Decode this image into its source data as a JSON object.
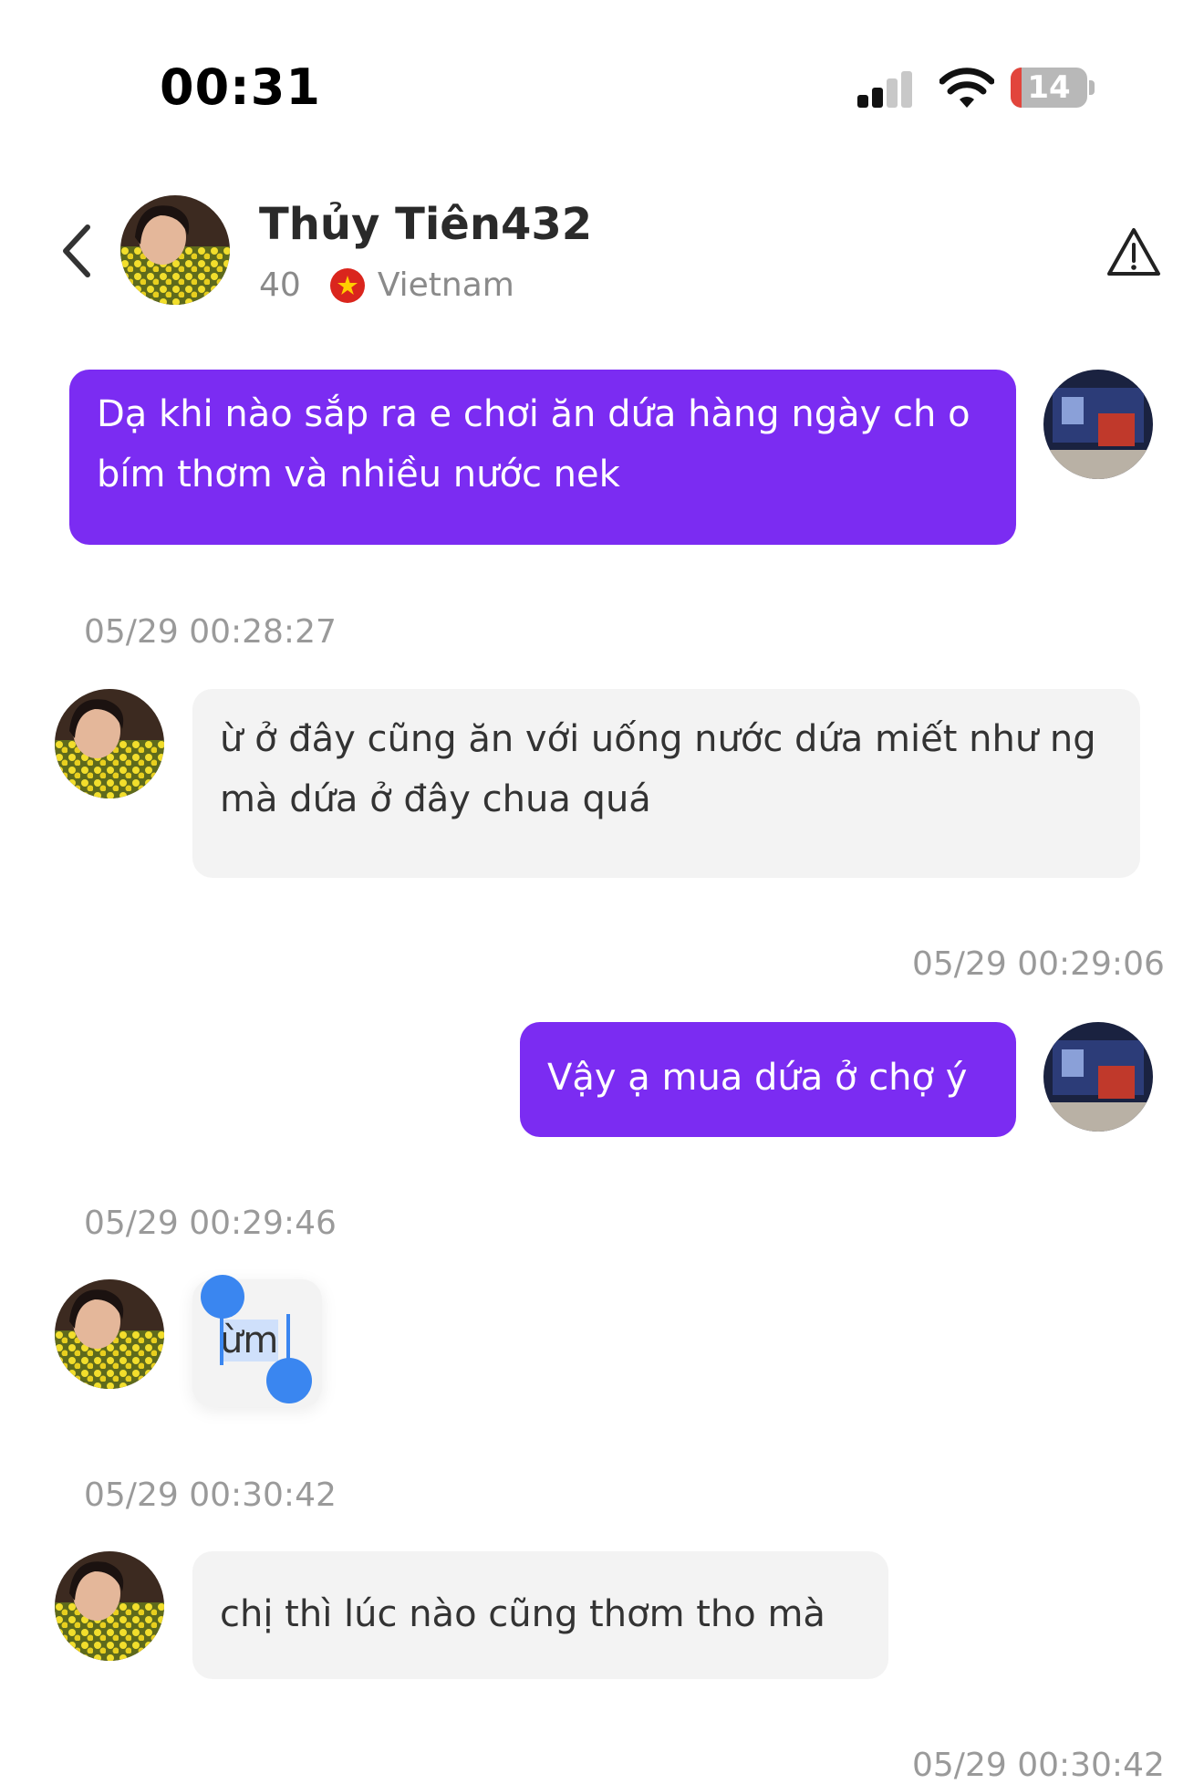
{
  "status_bar": {
    "time": "00:31",
    "battery_level": "14",
    "battery_fraction": 0.14,
    "icons": [
      "signal-icon",
      "wifi-icon",
      "battery-icon"
    ]
  },
  "header": {
    "name": "Thủy Tiên432",
    "age": "40",
    "country": "Vietnam",
    "icons": [
      "back-chevron-icon",
      "vietnam-flag-icon",
      "warning-triangle-icon"
    ]
  },
  "messages": [
    {
      "direction": "sent",
      "text": "Dạ khi nào sắp ra e chơi ăn dứa hàng ngày ch o bím thơm và nhiều nước nek"
    },
    {
      "direction": "received",
      "time": "05/29 00:28:27",
      "text": "ừ ở đây cũng ăn với uống nước dứa miết như ng mà dứa ở đây chua quá"
    },
    {
      "direction": "sent",
      "time": "05/29 00:29:06",
      "text": "Vậy ạ mua dứa ở chợ ý"
    },
    {
      "direction": "received",
      "time": "05/29 00:29:46",
      "text": "ừm",
      "selected": true
    },
    {
      "direction": "received",
      "time": "05/29 00:30:42",
      "text": "chị thì lúc nào cũng thơm tho mà"
    },
    {
      "direction": "sent",
      "time": "05/29 00:30:42"
    }
  ],
  "colors": {
    "sent_bubble": "#7b2cf2",
    "received_bubble": "#f3f3f3",
    "selection_handle": "#3a86f0",
    "battery_low": "#e2453c"
  }
}
